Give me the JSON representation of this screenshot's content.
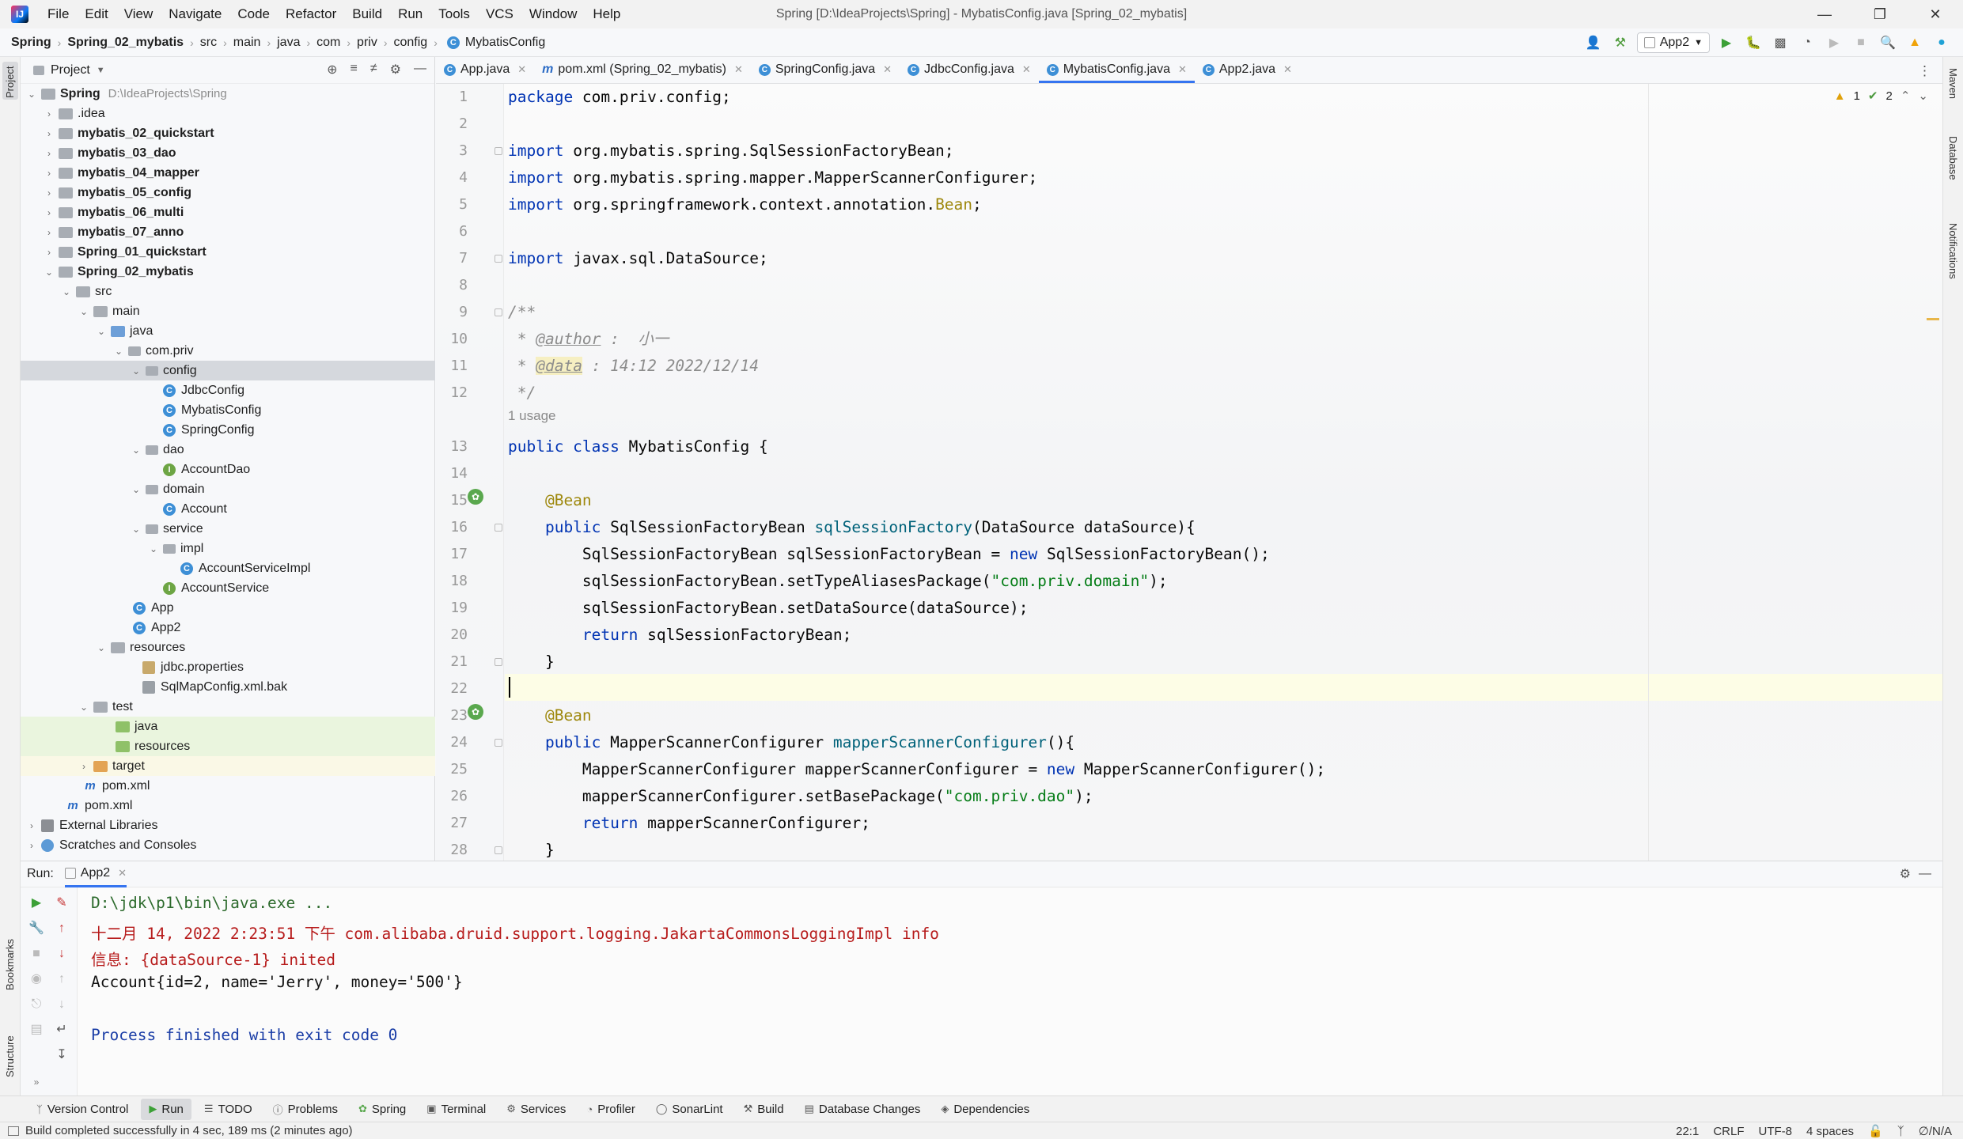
{
  "menu": {
    "items": [
      "File",
      "Edit",
      "View",
      "Navigate",
      "Code",
      "Refactor",
      "Build",
      "Run",
      "Tools",
      "VCS",
      "Window",
      "Help"
    ],
    "window_title": "Spring [D:\\IdeaProjects\\Spring] - MybatisConfig.java [Spring_02_mybatis]"
  },
  "breadcrumb": [
    "Spring",
    "Spring_02_mybatis",
    "src",
    "main",
    "java",
    "com",
    "priv",
    "config",
    "MybatisConfig"
  ],
  "toolbar": {
    "run_config": "App2"
  },
  "project": {
    "title": "Project",
    "root_label": "Spring",
    "root_path": "D:\\IdeaProjects\\Spring",
    "nodes": [
      {
        "label": ".idea"
      },
      {
        "label": "mybatis_02_quickstart"
      },
      {
        "label": "mybatis_03_dao"
      },
      {
        "label": "mybatis_04_mapper"
      },
      {
        "label": "mybatis_05_config"
      },
      {
        "label": "mybatis_06_multi"
      },
      {
        "label": "mybatis_07_anno"
      },
      {
        "label": "Spring_01_quickstart"
      },
      {
        "label": "Spring_02_mybatis"
      },
      {
        "label": "src"
      },
      {
        "label": "main"
      },
      {
        "label": "java"
      },
      {
        "label": "com.priv"
      },
      {
        "label": "config"
      },
      {
        "label": "JdbcConfig"
      },
      {
        "label": "MybatisConfig"
      },
      {
        "label": "SpringConfig"
      },
      {
        "label": "dao"
      },
      {
        "label": "AccountDao"
      },
      {
        "label": "domain"
      },
      {
        "label": "Account"
      },
      {
        "label": "service"
      },
      {
        "label": "impl"
      },
      {
        "label": "AccountServiceImpl"
      },
      {
        "label": "AccountService"
      },
      {
        "label": "App"
      },
      {
        "label": "App2"
      },
      {
        "label": "resources"
      },
      {
        "label": "jdbc.properties"
      },
      {
        "label": "SqlMapConfig.xml.bak"
      },
      {
        "label": "test"
      },
      {
        "label": "java"
      },
      {
        "label": "resources"
      },
      {
        "label": "target"
      },
      {
        "label": "pom.xml"
      },
      {
        "label": "pom.xml"
      },
      {
        "label": "External Libraries"
      },
      {
        "label": "Scratches and Consoles"
      }
    ]
  },
  "tabs": [
    {
      "label": "App.java"
    },
    {
      "label": "pom.xml (Spring_02_mybatis)"
    },
    {
      "label": "SpringConfig.java"
    },
    {
      "label": "JdbcConfig.java"
    },
    {
      "label": "MybatisConfig.java"
    },
    {
      "label": "App2.java"
    }
  ],
  "editor": {
    "inspections": {
      "warnings": "1",
      "weak_warnings": "2"
    },
    "usage_hint": "1 usage",
    "line_numbers": [
      "1",
      "2",
      "3",
      "4",
      "5",
      "6",
      "7",
      "8",
      "9",
      "10",
      "11",
      "12",
      "13",
      "14",
      "15",
      "16",
      "17",
      "18",
      "19",
      "20",
      "21",
      "22",
      "23",
      "24",
      "25",
      "26",
      "27",
      "28"
    ],
    "code": {
      "l1_kw": "package",
      "l1_rest": " com.priv.config;",
      "l3_kw": "import",
      "l3_rest": " org.mybatis.spring.SqlSessionFactoryBean;",
      "l4_kw": "import",
      "l4_rest": " org.mybatis.spring.mapper.MapperScannerConfigurer;",
      "l5_kw": "import",
      "l5_rest": " org.springframework.context.annotation.",
      "l5_ann": "Bean",
      "l5_end": ";",
      "l7_kw": "import",
      "l7_rest": " javax.sql.DataSource;",
      "l9": "/**",
      "l10_pre": " * ",
      "l10_tag": "@author",
      "l10_rest": " :  小一",
      "l11_pre": " * ",
      "l11_tag": "@data",
      "l11_rest": " : 14:12 2022/12/14",
      "l12": " */",
      "l13_kw": "public class",
      "l13_rest": " MybatisConfig {",
      "l15_ann": "    @Bean",
      "l16_kw": "    public",
      "l16_type": " SqlSessionFactoryBean ",
      "l16_mth": "sqlSessionFactory",
      "l16_rest": "(DataSource dataSource){",
      "l17_a": "        SqlSessionFactoryBean sqlSessionFactoryBean = ",
      "l17_kw": "new",
      "l17_b": " SqlSessionFactoryBean();",
      "l18_a": "        sqlSessionFactoryBean.setTypeAliasesPackage(",
      "l18_str": "\"com.priv.domain\"",
      "l18_b": ");",
      "l19": "        sqlSessionFactoryBean.setDataSource(dataSource);",
      "l20_kw": "        return",
      "l20_rest": " sqlSessionFactoryBean;",
      "l21": "    }",
      "l23_ann": "    @Bean",
      "l24_kw": "    public",
      "l24_type": " MapperScannerConfigurer ",
      "l24_mth": "mapperScannerConfigurer",
      "l24_rest": "(){",
      "l25_a": "        MapperScannerConfigurer mapperScannerConfigurer = ",
      "l25_kw": "new",
      "l25_b": " MapperScannerConfigurer();",
      "l26_a": "        mapperScannerConfigurer.setBasePackage(",
      "l26_str": "\"com.priv.dao\"",
      "l26_b": ");",
      "l27_kw": "        return",
      "l27_rest": " mapperScannerConfigurer;",
      "l28": "    }"
    }
  },
  "run": {
    "label": "Run:",
    "tab": "App2",
    "console": [
      "D:\\jdk\\p1\\bin\\java.exe ...",
      "十二月 14, 2022 2:23:51 下午 com.alibaba.druid.support.logging.JakartaCommonsLoggingImpl info",
      "信息: {dataSource-1} inited",
      "Account{id=2, name='Jerry', money='500'}",
      "Process finished with exit code 0"
    ]
  },
  "toolwindows": [
    "Version Control",
    "Run",
    "TODO",
    "Problems",
    "Spring",
    "Terminal",
    "Services",
    "Profiler",
    "SonarLint",
    "Build",
    "Database Changes",
    "Dependencies"
  ],
  "status": {
    "message": "Build completed successfully in 4 sec, 189 ms (2 minutes ago)",
    "position": "22:1",
    "line_sep": "CRLF",
    "encoding": "UTF-8",
    "indent": "4 spaces",
    "vcs": "∅/N/A"
  },
  "stripes": {
    "left_top": "Project",
    "left_b1": "Bookmarks",
    "left_b2": "Structure",
    "right1": "Maven",
    "right2": "Database",
    "right3": "Notifications"
  },
  "colors": {
    "keyword": "#0033b3",
    "annotation": "#9e880d",
    "string": "#067d17",
    "error_console": "#b71c1c",
    "accent": "#3574f0"
  }
}
